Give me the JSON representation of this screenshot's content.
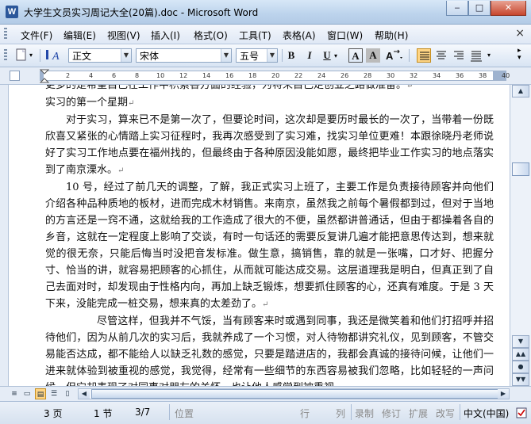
{
  "window": {
    "title": "大学生文员实习周记大全(20篇).doc - Microsoft Word",
    "app_icon": "W"
  },
  "menu": [
    "文件(F)",
    "编辑(E)",
    "视图(V)",
    "插入(I)",
    "格式(O)",
    "工具(T)",
    "表格(A)",
    "窗口(W)",
    "帮助(H)"
  ],
  "menu_close": "×",
  "toolbar": {
    "style": "正文",
    "font": "宋体",
    "size": "五号",
    "bold": "B",
    "italic": "I",
    "underline": "U",
    "char_border": "A",
    "char_shade": "A"
  },
  "ruler_ticks": [
    "2",
    "4",
    "6",
    "8",
    "10",
    "12",
    "14",
    "16",
    "18",
    "20",
    "22",
    "24",
    "26",
    "28",
    "30",
    "32",
    "34",
    "36",
    "38",
    "40"
  ],
  "document": {
    "paragraphs": [
      "更多的是希望自己在工作中积累各方面的经验，为将来自己走创业之路做准备。",
      "实习的第一个星期",
      "对于实习，算来已不是第一次了，但要论时间，这次却是要历时最长的一次了，当带着一份既欣喜又紧张的心情踏上实习征程时，我再次感受到了实习难，找实习单位更难！本跟徐晓丹老师说好了实习工作地点要在福州找的，但最终由于各种原因没能如愿，最终把毕业工作实习的地点落实到了南京溧水。",
      "10 号，经过了前几天的调整，了解，我正式实习上班了，主要工作是负责接待顾客并向他们介绍各种品种质地的板材，进而完成木材销售。来南京，虽然我之前每个暑假都到过，但对于当地的方言还是一窍不通，这就给我的工作造成了很大的不便，虽然都讲普通话，但由于都操着各自的乡音，这就在一定程度上影响了交谈，有时一句话还的需要反复讲几遍才能把意思传达到，想来就觉的很无奈，只能后悔当时没把音发标准。做生意，搞销售，靠的就是一张嘴，口才好、把握分寸、恰当的讲，就容易把顾客的心抓住，从而就可能达成交易。这层道理我是明白，但真正到了自己去面对时，却发现由于性格内向，再加上缺乏锻炼，想要抓住顾客的心，还真有难度。于是 3 天下来，没能完成一桩交易，想来真的太差劲了。",
      "尽管这样，但我并不气馁，当有顾客来时或遇到同事，我还是微笑着和他们打招呼并招待他们，因为从前几次的实习后，我就养成了一个习惯，对人待物都讲究礼仪，见到顾客，不管交易能否达成，都不能给人以缺乏礼数的感觉，只要是踏进店的，我都会真诚的接待问候，让他们一进来就体验到被重视的感觉，我觉得，经常有一些细节的东西容易被我们忽略，比如轻轻的一声问候，但它却表现了对同事对朋友的关怀，也让他人感觉到被重视"
    ]
  },
  "status": {
    "page": "3 页",
    "section": "1 节",
    "pages": "3/7",
    "position": "位置",
    "line": "行",
    "column": "列",
    "rec": "录制",
    "trk": "修订",
    "ext": "扩展",
    "ovr": "改写",
    "language": "中文(中国)"
  }
}
